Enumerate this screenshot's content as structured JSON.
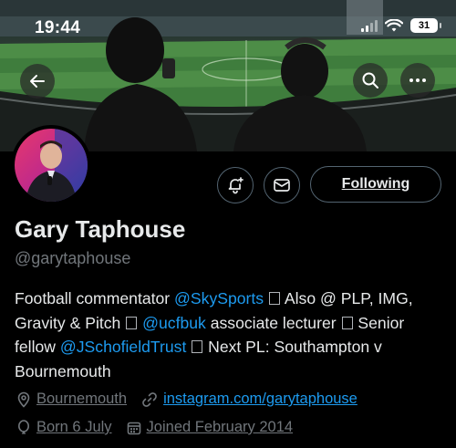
{
  "status_bar": {
    "time": "19:44",
    "battery": "31"
  },
  "profile": {
    "display_name": "Gary Taphouse",
    "handle": "@garytaphouse",
    "bio": {
      "t1": "Football commentator ",
      "m1": "@SkySports",
      "t2": " Also @ PLP, IMG, Gravity & Pitch ",
      "m2": "@ucfbuk",
      "t3": " associate lecturer ",
      "t4": " Senior fellow ",
      "m3": "@JSchofieldTrust",
      "t5": " Next PL: Southampton v Bournemouth"
    },
    "location": "Bournemouth",
    "website": "instagram.com/garytaphouse",
    "birthday": "Born 6 July",
    "joined": "Joined February 2014"
  },
  "actions": {
    "following_label": "Following"
  },
  "icons": {
    "back": "arrow-left-icon",
    "search": "search-icon",
    "more": "more-icon",
    "notify": "bell-plus-icon",
    "message": "envelope-icon",
    "location": "location-pin-icon",
    "link": "link-icon",
    "birthday": "balloon-icon",
    "calendar": "calendar-icon"
  },
  "colors": {
    "accent": "#1d9bf0",
    "muted": "#71767b",
    "border": "#536471",
    "background": "#000000"
  }
}
